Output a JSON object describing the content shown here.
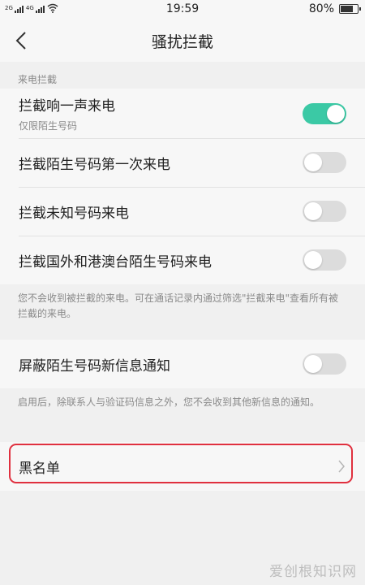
{
  "status_bar": {
    "network_label_1": "2G",
    "network_label_2": "4G",
    "time": "19:59",
    "battery_percent_text": "80%",
    "battery_level": 0.8
  },
  "app_bar": {
    "title": "骚扰拦截",
    "back_icon": "chevron-left-icon"
  },
  "sections": {
    "call_block": {
      "header": "来电拦截",
      "items": [
        {
          "title": "拦截响一声来电",
          "subtitle": "仅限陌生号码",
          "enabled": true
        },
        {
          "title": "拦截陌生号码第一次来电",
          "enabled": false
        },
        {
          "title": "拦截未知号码来电",
          "enabled": false
        },
        {
          "title": "拦截国外和港澳台陌生号码来电",
          "enabled": false
        }
      ],
      "footnote": "您不会收到被拦截的来电。可在通话记录内通过筛选\"拦截来电\"查看所有被拦截的来电。"
    },
    "sms_block": {
      "items": [
        {
          "title": "屏蔽陌生号码新信息通知",
          "enabled": false
        }
      ],
      "footnote": "启用后，除联系人与验证码信息之外，您不会收到其他新信息的通知。"
    },
    "blacklist": {
      "label": "黑名单",
      "chevron_icon": "chevron-right-icon"
    }
  },
  "colors": {
    "accent_toggle_on": "#3bc9a5",
    "highlight_border": "#e0303f"
  },
  "watermark": "爱创根知识网"
}
